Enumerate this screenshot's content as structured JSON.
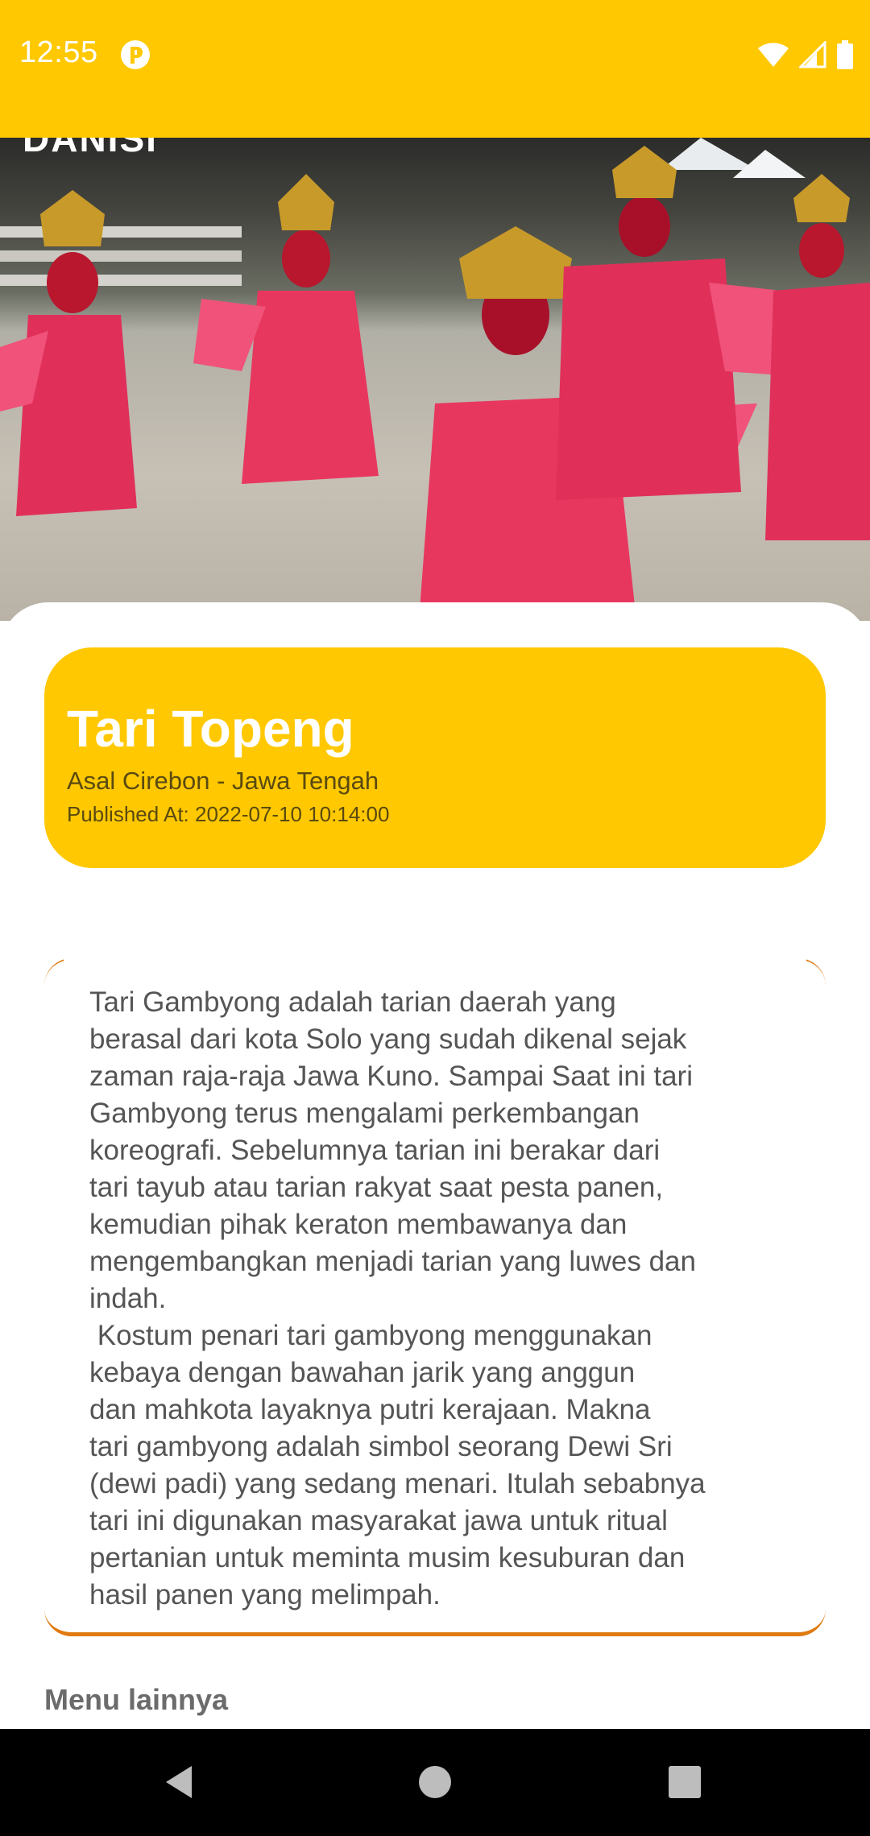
{
  "status_bar": {
    "time": "12:55",
    "color": "#FFC800",
    "icons": [
      "app-notification-icon",
      "wifi-icon",
      "cellular-signal-icon",
      "battery-icon"
    ]
  },
  "hero": {
    "title": "DANISI"
  },
  "detail": {
    "title": "Tari Topeng",
    "origin": "Asal Cirebon - Jawa Tengah",
    "published": "Published At: 2022-07-10 10:14:00"
  },
  "description": {
    "text": "Tari Gambyong adalah tarian daerah yang\nberasal dari kota Solo yang sudah dikenal sejak\nzaman raja-raja Jawa Kuno. Sampai Saat ini tari\nGambyong terus mengalami perkembangan\nkoreografi. Sebelumnya tarian ini berakar dari\ntari tayub atau tarian rakyat saat pesta panen,\nkemudian pihak keraton membawanya dan\nmengembangkan menjadi tarian yang luwes dan\nindah.\n Kostum penari tari gambyong menggunakan\nkebaya dengan bawahan jarik yang anggun\ndan mahkota layaknya putri kerajaan. Makna\ntari gambyong adalah simbol seorang Dewi Sri\n(dewi padi) yang sedang menari. Itulah sebabnya\ntari ini digunakan masyarakat jawa untuk ritual\npertanian untuk meminta musim kesuburan dan\nhasil panen yang melimpah."
  },
  "more": {
    "label": "Menu lainnya"
  },
  "nav_bar": {
    "icons": [
      "back-icon",
      "home-icon",
      "recents-icon"
    ]
  },
  "colors": {
    "accent": "#FFC800",
    "border": "#E07A10"
  }
}
